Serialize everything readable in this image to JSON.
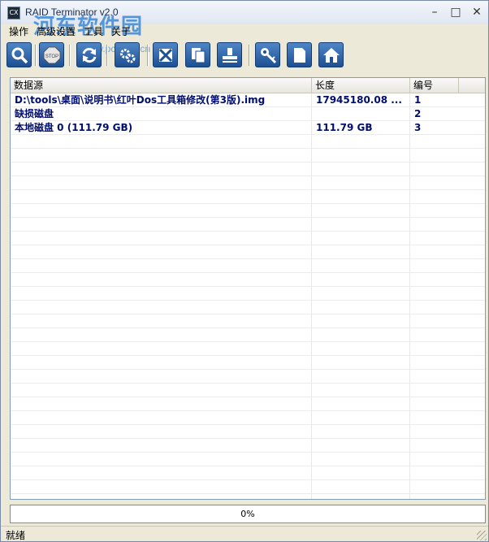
{
  "window": {
    "title": "RAID Terminator v2.0",
    "watermark": "河东软件园",
    "watermark_url": "www.pc0359.cn"
  },
  "menu": [
    "操作",
    "高级设置",
    "工具",
    "关于"
  ],
  "toolbar": [
    "search-icon",
    "stop-icon",
    "refresh-icon",
    "settings-icon",
    "cancel-icon",
    "copy-icon",
    "save-icon",
    "key-icon",
    "document-icon",
    "home-icon"
  ],
  "table": {
    "columns": [
      "数据源",
      "长度",
      "编号"
    ],
    "rows": [
      {
        "source": "D:\\tools\\桌面\\说明书\\红叶Dos工具箱修改(第3版).img",
        "length": "17945180.08  ...",
        "id": "1"
      },
      {
        "source": "缺损磁盘",
        "length": "",
        "id": "2"
      },
      {
        "source": "本地磁盘 0 (111.79 GB)",
        "length": "111.79  GB",
        "id": "3"
      }
    ]
  },
  "progress": {
    "label": "0%",
    "value": 0
  },
  "status": "就绪"
}
